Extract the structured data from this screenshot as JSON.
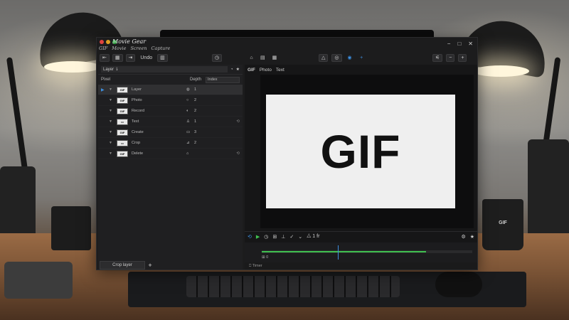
{
  "app": {
    "title": "Movie Gear",
    "menus": [
      "GIF",
      "Movie",
      "Screen",
      "Capture"
    ]
  },
  "toolbar": {
    "left_buttons": [
      "⇤",
      "▦",
      "⇥",
      "Undo",
      "▥"
    ],
    "left_timer": "◷",
    "right_buttons": [
      "△",
      "◎",
      "◉",
      "+"
    ],
    "far_right": [
      "⚟",
      "−",
      "+"
    ],
    "tool_group": [
      "⌂",
      "▤",
      "▦"
    ],
    "window_controls": [
      "−",
      "□",
      "✕"
    ]
  },
  "left_panel": {
    "layer_input": "Layer ⇂",
    "header_icons": [
      "◔",
      "★"
    ],
    "sort_label": "Pixel",
    "select_label": "Depth",
    "select_value": "Index",
    "rows": [
      {
        "name": "Layer",
        "thumb": "GIF",
        "icon": "◍",
        "count": "1",
        "active": true,
        "sync": ""
      },
      {
        "name": "Photo",
        "thumb": "GIF",
        "icon": "○",
        "count": "2",
        "active": false,
        "sync": ""
      },
      {
        "name": "Record",
        "thumb": "GIF",
        "icon": "◐",
        "count": "2",
        "active": false,
        "sync": ""
      },
      {
        "name": "Text",
        "thumb": "▭",
        "icon": "♙",
        "count": "1",
        "active": false,
        "sync": "⟲"
      },
      {
        "name": "Create",
        "thumb": "GIF",
        "icon": "▭",
        "count": "3",
        "active": false,
        "sync": ""
      },
      {
        "name": "Crop",
        "thumb": "▭",
        "icon": "⊿",
        "count": "2",
        "active": false,
        "sync": ""
      },
      {
        "name": "Delete",
        "thumb": "GIF",
        "icon": "⌂",
        "count": "",
        "active": false,
        "sync": "⟲"
      }
    ],
    "footer_button": "Crop layer",
    "add_button": "+"
  },
  "right_panel": {
    "tabs": [
      "GIF",
      "Photo",
      "Text"
    ],
    "canvas_text": "GIF",
    "controls": [
      "⟲",
      "▶",
      "◷",
      "⊞",
      "⊥",
      "✓",
      "⌄"
    ],
    "ctrl_label": "⧊ 1 fr",
    "ctrl_right": [
      "⚙",
      "★"
    ],
    "timeline": {
      "label": "⊞ 0",
      "progress": 0.78,
      "playhead": 0.36
    },
    "status": "⎕ Timer"
  },
  "colors": {
    "accent": "#3d8fe0",
    "progress": "#3fbf4f",
    "window_bg": "#1c1c1d"
  }
}
